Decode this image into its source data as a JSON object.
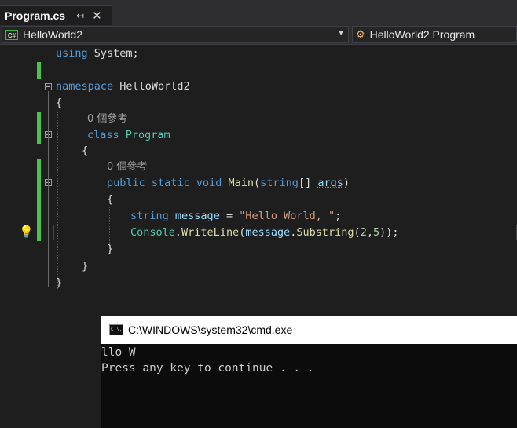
{
  "tab": {
    "title": "Program.cs",
    "pin_glyph": "↤",
    "close_glyph": "✕"
  },
  "navbar": {
    "project": "HelloWorld2",
    "member": "HelloWorld2.Program",
    "project_icon_text": "C#"
  },
  "code": {
    "line1": {
      "kw": "using",
      "rest": " System;"
    },
    "line2": {
      "kw": "namespace",
      "name": " HelloWorld2"
    },
    "line3": "{",
    "line4_ref": "0 個參考",
    "line5": {
      "kw": "class",
      "name": "Program"
    },
    "line6": "{",
    "line7_ref": "0 個參考",
    "line8": {
      "kw1": "public",
      "kw2": "static",
      "kw3": "void",
      "fn": "Main",
      "p1": "(",
      "kw4": "string",
      "p2": "[] ",
      "arg": "args",
      "p3": ")"
    },
    "line9": "{",
    "line10": {
      "kw": "string",
      "var": "message",
      "eq": " = ",
      "str": "\"Hello World, \"",
      "end": ";"
    },
    "line11": {
      "cls": "Console",
      "dot": ".",
      "fn": "WriteLine",
      "p1": "(",
      "var": "message",
      "dot2": ".",
      "fn2": "Substring",
      "p2": "(",
      "n1": "2",
      "comma": ",",
      "n2": "5",
      "p3": "));"
    },
    "line12": "}",
    "line13": "}",
    "line14": "}"
  },
  "console": {
    "title": "C:\\WINDOWS\\system32\\cmd.exe",
    "icon_text": "C:\\.",
    "output": [
      "llo W",
      "Press any key to continue . . ."
    ]
  },
  "colors": {
    "keyword": "#569cd6",
    "type": "#4ec9b0",
    "string": "#d69d85",
    "method": "#dcdcaa",
    "variable": "#9cdcfe",
    "change_bar": "#4ec14e"
  }
}
